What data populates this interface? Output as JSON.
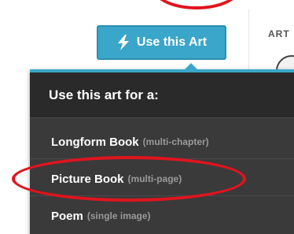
{
  "button": {
    "label": "Use this Art",
    "icon": "lightning-bolt-icon"
  },
  "side_panel": {
    "header": "ART"
  },
  "dropdown": {
    "header": "Use this art for a:",
    "items": [
      {
        "label": "Longform Book",
        "sub": "(multi-chapter)"
      },
      {
        "label": "Picture Book",
        "sub": "(multi-page)"
      },
      {
        "label": "Poem",
        "sub": "(single image)"
      }
    ]
  },
  "colors": {
    "button": "#3aa6c9",
    "dropdown_bg": "#3a3a3a",
    "annotation": "#e0141e"
  }
}
